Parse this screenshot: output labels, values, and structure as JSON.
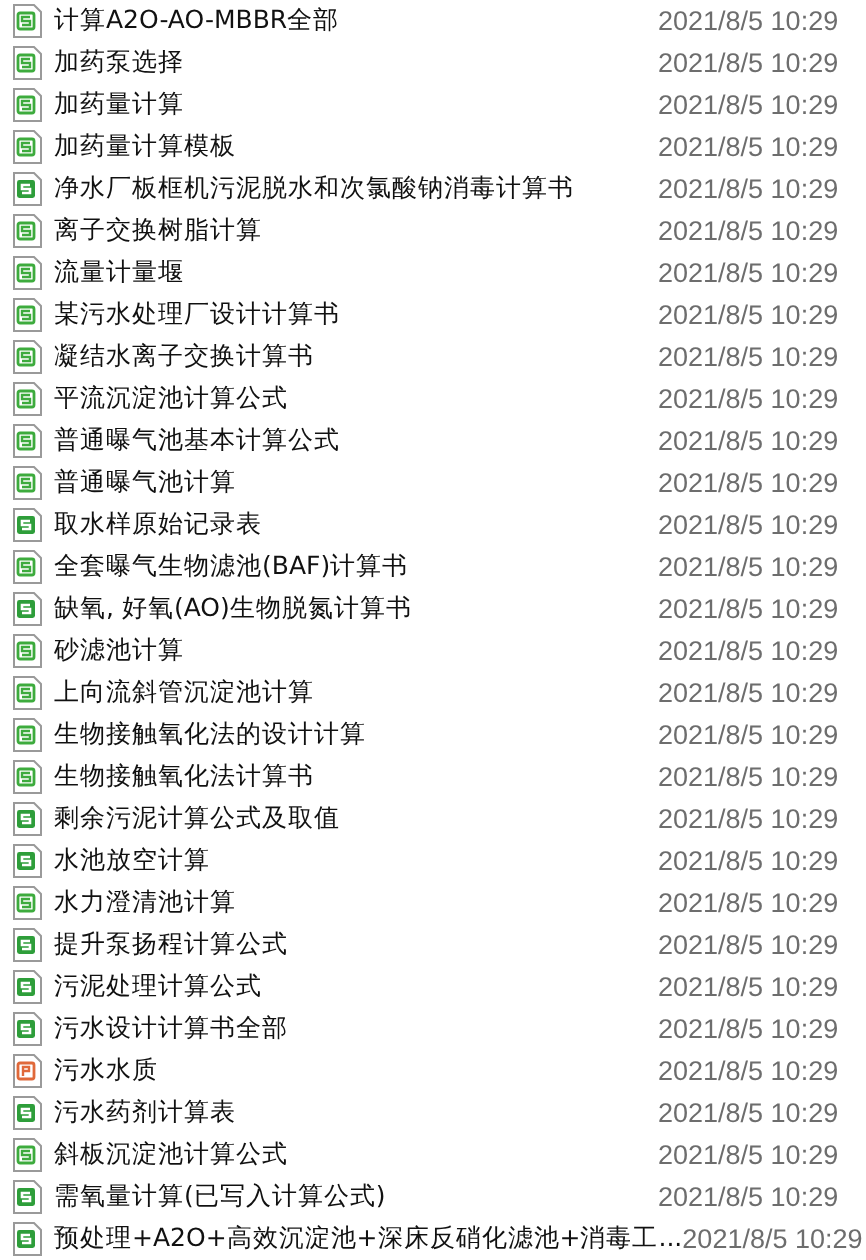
{
  "files": [
    {
      "name": "计算A2O-AO-MBBR全部",
      "date": "2021/8/5 10:29",
      "kind": "xls"
    },
    {
      "name": "加药泵选择",
      "date": "2021/8/5 10:29",
      "kind": "xls"
    },
    {
      "name": "加药量计算",
      "date": "2021/8/5 10:29",
      "kind": "xls"
    },
    {
      "name": "加药量计算模板",
      "date": "2021/8/5 10:29",
      "kind": "xls"
    },
    {
      "name": "净水厂板框机污泥脱水和次氯酸钠消毒计算书",
      "date": "2021/8/5 10:29",
      "kind": "xlsx"
    },
    {
      "name": "离子交换树脂计算",
      "date": "2021/8/5 10:29",
      "kind": "xls"
    },
    {
      "name": "流量计量堰",
      "date": "2021/8/5 10:29",
      "kind": "xls"
    },
    {
      "name": "某污水处理厂设计计算书",
      "date": "2021/8/5 10:29",
      "kind": "xls"
    },
    {
      "name": "凝结水离子交换计算书",
      "date": "2021/8/5 10:29",
      "kind": "xls"
    },
    {
      "name": "平流沉淀池计算公式",
      "date": "2021/8/5 10:29",
      "kind": "xls"
    },
    {
      "name": "普通曝气池基本计算公式",
      "date": "2021/8/5 10:29",
      "kind": "xls"
    },
    {
      "name": "普通曝气池计算",
      "date": "2021/8/5 10:29",
      "kind": "xls"
    },
    {
      "name": "取水样原始记录表",
      "date": "2021/8/5 10:29",
      "kind": "xlsx"
    },
    {
      "name": "全套曝气生物滤池(BAF)计算书",
      "date": "2021/8/5 10:29",
      "kind": "xls"
    },
    {
      "name": "缺氧, 好氧(AO)生物脱氮计算书",
      "date": "2021/8/5 10:29",
      "kind": "xlsx"
    },
    {
      "name": "砂滤池计算",
      "date": "2021/8/5 10:29",
      "kind": "xls"
    },
    {
      "name": "上向流斜管沉淀池计算",
      "date": "2021/8/5 10:29",
      "kind": "xls"
    },
    {
      "name": "生物接触氧化法的设计计算",
      "date": "2021/8/5 10:29",
      "kind": "xls"
    },
    {
      "name": "生物接触氧化法计算书",
      "date": "2021/8/5 10:29",
      "kind": "xls"
    },
    {
      "name": "剩余污泥计算公式及取值",
      "date": "2021/8/5 10:29",
      "kind": "xlsx"
    },
    {
      "name": "水池放空计算",
      "date": "2021/8/5 10:29",
      "kind": "xlsx"
    },
    {
      "name": "水力澄清池计算",
      "date": "2021/8/5 10:29",
      "kind": "xls"
    },
    {
      "name": "提升泵扬程计算公式",
      "date": "2021/8/5 10:29",
      "kind": "xlsx"
    },
    {
      "name": "污泥处理计算公式",
      "date": "2021/8/5 10:29",
      "kind": "xlsx"
    },
    {
      "name": "污水设计计算书全部",
      "date": "2021/8/5 10:29",
      "kind": "xlsx"
    },
    {
      "name": "污水水质",
      "date": "2021/8/5 10:29",
      "kind": "ppt"
    },
    {
      "name": "污水药剂计算表",
      "date": "2021/8/5 10:29",
      "kind": "xlsx"
    },
    {
      "name": "斜板沉淀池计算公式",
      "date": "2021/8/5 10:29",
      "kind": "xls"
    },
    {
      "name": "需氧量计算(已写入计算公式)",
      "date": "2021/8/5 10:29",
      "kind": "xlsx"
    },
    {
      "name": "预处理+A2O+高效沉淀池+深床反硝化滤池+消毒工...",
      "date": "2021/8/5 10:29",
      "kind": "xlsx"
    }
  ]
}
